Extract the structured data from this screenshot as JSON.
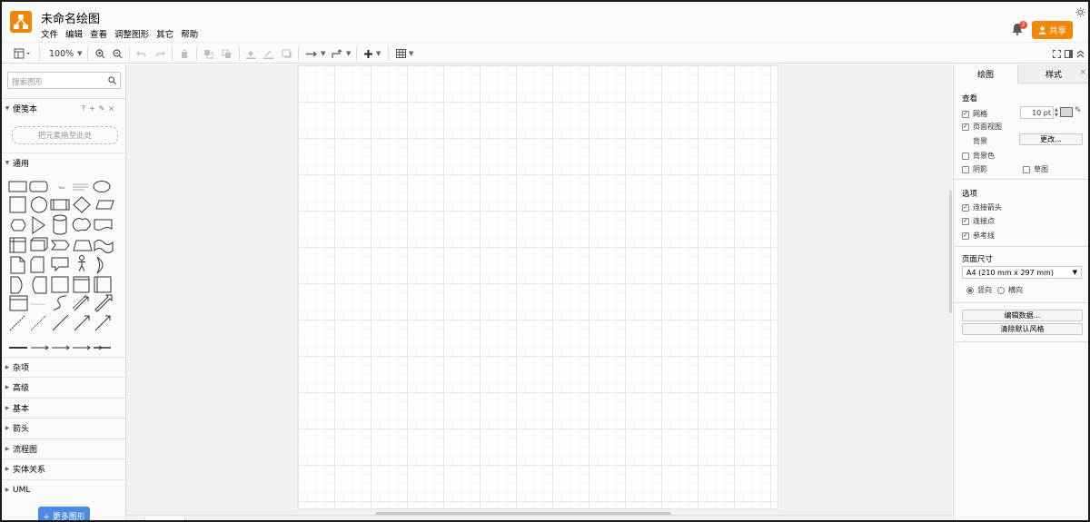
{
  "header": {
    "doc_title": "未命名绘图",
    "menu": [
      "文件",
      "编辑",
      "查看",
      "调整图形",
      "其它",
      "帮助"
    ],
    "notification_count": "2",
    "share_label": "共享"
  },
  "toolbar": {
    "zoom": "100%"
  },
  "sidebar": {
    "search_placeholder": "搜索图形",
    "scratchpad_title": "便笺本",
    "scratchpad_drop": "把元素拖至此处",
    "general_title": "通用",
    "sections": [
      "杂项",
      "高级",
      "基本",
      "箭头",
      "流程图",
      "实体关系",
      "UML"
    ],
    "more_shapes": "+ 更多图形"
  },
  "format_panel": {
    "tabs": [
      "绘图",
      "样式"
    ],
    "view_title": "查看",
    "grid_label": "网格",
    "grid_size": "10 pt",
    "page_view_label": "页面视图",
    "background_label": "背景",
    "change_button": "更改...",
    "background_color_label": "背景色",
    "shadow_label": "阴影",
    "sketch_label": "草图",
    "options_title": "选项",
    "connection_arrows": "连接箭头",
    "connection_points": "连接点",
    "guides": "参考线",
    "paper_size_title": "页面尺寸",
    "paper_size_value": "A4 (210 mm x 297 mm)",
    "portrait": "竖向",
    "landscape": "横向",
    "edit_data_button": "编辑数据...",
    "clear_style_button": "清除默认风格"
  },
  "colors": {
    "accent": "#f08705",
    "more_shapes_button": "#4a8ae5"
  }
}
